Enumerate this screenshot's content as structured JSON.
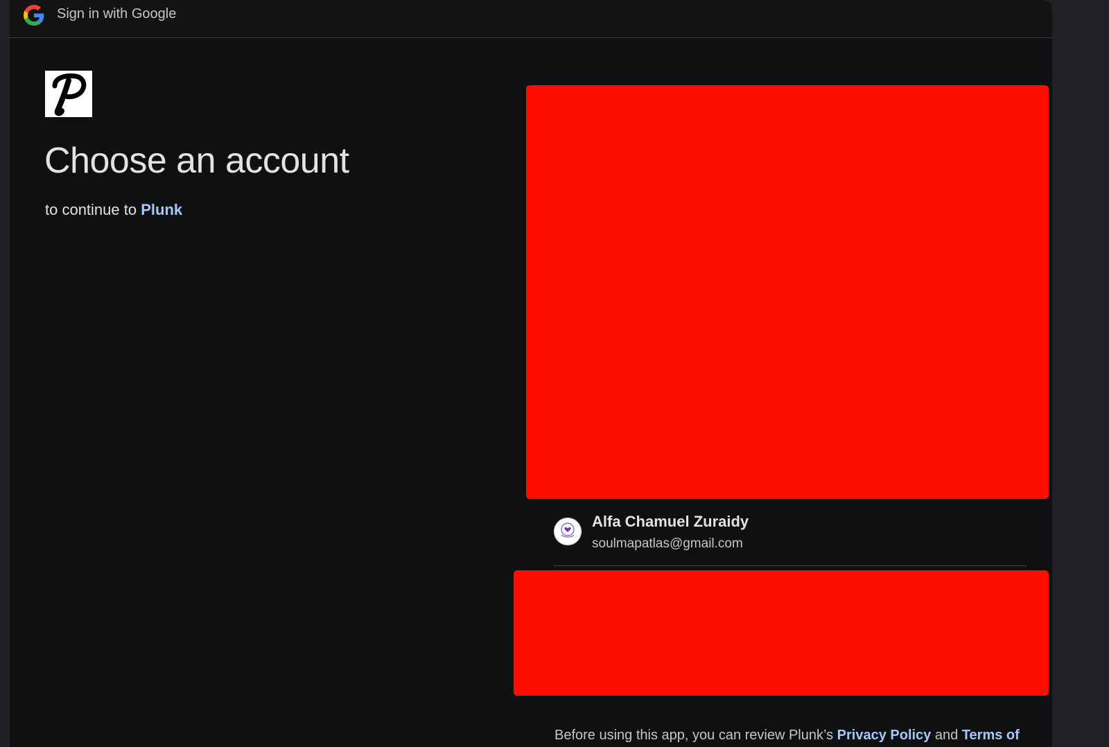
{
  "titlebar": {
    "title": "Sign in with Google",
    "icon": "google-g-icon"
  },
  "app": {
    "logo_icon": "plunk-p-logo"
  },
  "main": {
    "heading": "Choose an account",
    "subtitle_prefix": "to continue to",
    "app_name": "Plunk"
  },
  "account": {
    "name": "Alfa Chamuel Zuraidy",
    "email": "soulmapatlas@gmail.com",
    "avatar_icon": "soul-map-atlas-avatar"
  },
  "footer": {
    "text_prefix": "Before using this app, you can review Plunk’s",
    "privacy_link": "Privacy Policy",
    "and": "and",
    "terms_link": "Terms of"
  },
  "colors": {
    "background": "#0f1011",
    "text": "#e3e3e3",
    "link": "#a8c7fa",
    "redaction": "#ff0d00"
  }
}
